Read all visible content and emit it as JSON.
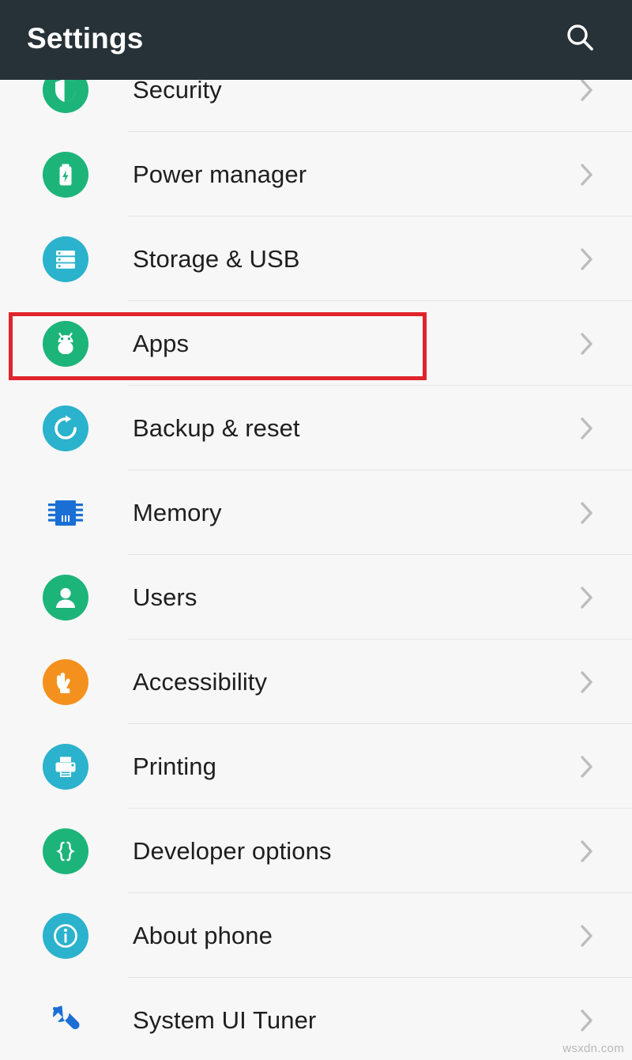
{
  "header": {
    "title": "Settings",
    "search_icon": "search-icon",
    "background_color": "#273238",
    "title_color": "#ffffff"
  },
  "annotation": {
    "target_row": "Apps",
    "color": "#e0242c",
    "shape": "rectangle"
  },
  "watermark": {
    "text": "wsxdn.com"
  },
  "list": {
    "chevron_glyph": "›",
    "chevron_color": "#bdbdbd",
    "divider_color": "#e4e4e4",
    "background_color": "#f7f7f7",
    "items": [
      {
        "label": "Security",
        "icon": "shield-icon",
        "icon_color": "#1db47a",
        "icon_shape": "circle",
        "clipped": true,
        "highlighted": false
      },
      {
        "label": "Power manager",
        "icon": "battery-icon",
        "icon_color": "#1db47a",
        "icon_shape": "circle",
        "clipped": false,
        "highlighted": false
      },
      {
        "label": "Storage & USB",
        "icon": "storage-icon",
        "icon_color": "#2bb2cc",
        "icon_shape": "circle",
        "clipped": false,
        "highlighted": false
      },
      {
        "label": "Apps",
        "icon": "android-robot-icon",
        "icon_color": "#1db47a",
        "icon_shape": "circle",
        "clipped": false,
        "highlighted": true
      },
      {
        "label": "Backup & reset",
        "icon": "restore-icon",
        "icon_color": "#2bb2cc",
        "icon_shape": "circle",
        "clipped": false,
        "highlighted": false
      },
      {
        "label": "Memory",
        "icon": "memory-chip-icon",
        "icon_color": "#1a6fd4",
        "icon_shape": "plain",
        "clipped": false,
        "highlighted": false
      },
      {
        "label": "Users",
        "icon": "person-icon",
        "icon_color": "#1db47a",
        "icon_shape": "circle",
        "clipped": false,
        "highlighted": false
      },
      {
        "label": "Accessibility",
        "icon": "hand-pointer-icon",
        "icon_color": "#f4911e",
        "icon_shape": "circle",
        "clipped": false,
        "highlighted": false
      },
      {
        "label": "Printing",
        "icon": "printer-icon",
        "icon_color": "#2bb2cc",
        "icon_shape": "circle",
        "clipped": false,
        "highlighted": false
      },
      {
        "label": "Developer options",
        "icon": "braces-icon",
        "icon_color": "#1db47a",
        "icon_shape": "circle",
        "clipped": false,
        "highlighted": false
      },
      {
        "label": "About phone",
        "icon": "info-icon",
        "icon_color": "#2bb2cc",
        "icon_shape": "circle",
        "clipped": false,
        "highlighted": false
      },
      {
        "label": "System UI Tuner",
        "icon": "wrench-icon",
        "icon_color": "#1a6fd4",
        "icon_shape": "plain",
        "clipped": false,
        "highlighted": false
      }
    ]
  }
}
